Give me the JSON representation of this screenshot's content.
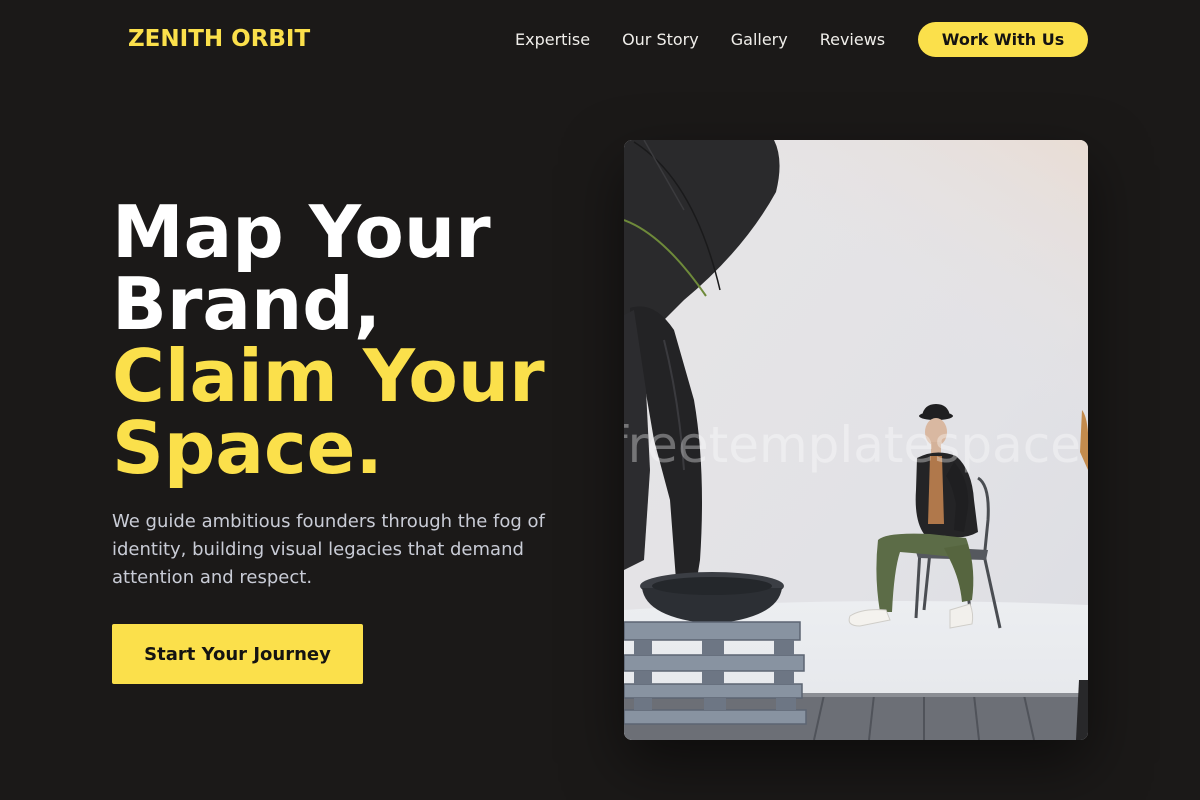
{
  "brand": {
    "logo_text": "ZENITH ORBIT"
  },
  "nav": {
    "items": [
      {
        "label": "Expertise"
      },
      {
        "label": "Our Story"
      },
      {
        "label": "Gallery"
      },
      {
        "label": "Reviews"
      }
    ],
    "cta_label": "Work With Us"
  },
  "hero": {
    "title_lines": [
      "Map Your",
      "Brand,",
      "Claim Your",
      "Space."
    ],
    "description": "We guide ambitious founders through the fog of identity, building visual legacies that demand attention and respect.",
    "cta_label": "Start Your Journey",
    "image_watermark": "freetemplatespace"
  },
  "colors": {
    "background": "#1b1918",
    "accent": "#fbe04b",
    "heading": "#ffffff",
    "body_text": "#c9ccd6"
  }
}
